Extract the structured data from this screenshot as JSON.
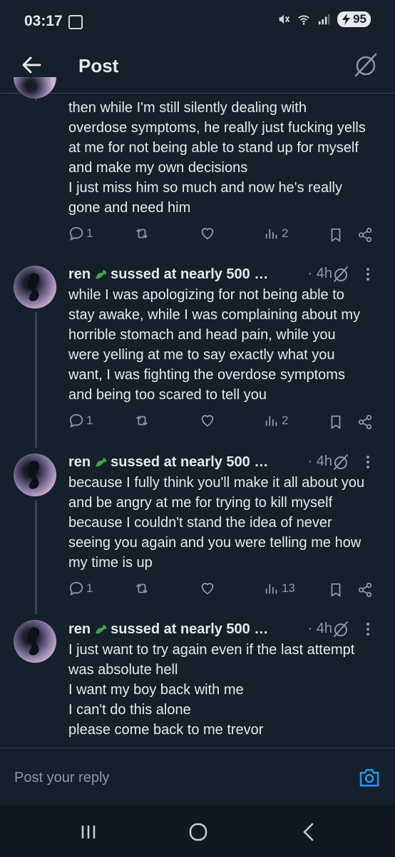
{
  "status_bar": {
    "time": "03:17",
    "battery": "95"
  },
  "header": {
    "title": "Post"
  },
  "posts": [
    {
      "text": "then while I'm still silently dealing with\noverdose symptoms, he really just fucking yells\nat me for not being able to stand up for myself\nand make my own decisions\nI just miss him so much and now he's really\ngone and need him",
      "replies": "1",
      "reposts": "",
      "likes": "",
      "views": "2"
    },
    {
      "author": "ren",
      "handle": "sussed at nearly 500 …",
      "time": "· 4h",
      "text": "while I was apologizing for not being able to\nstay awake, while I was complaining about my\nhorrible stomach and head pain, while you\nwere yelling at me to say exactly what you\nwant, I was fighting the overdose symptoms\nand being too scared to tell you",
      "replies": "1",
      "reposts": "",
      "likes": "",
      "views": "2"
    },
    {
      "author": "ren",
      "handle": "sussed at nearly 500 …",
      "time": "· 4h",
      "text": "because I fully think you'll make it all about you\nand be angry at me for trying to kill myself\nbecause I couldn't stand the idea of never\nseeing you again and you were telling me how\nmy time is up",
      "replies": "1",
      "reposts": "",
      "likes": "",
      "views": "13"
    },
    {
      "author": "ren",
      "handle": "sussed at nearly 500 …",
      "time": "· 4h",
      "text": "I just want to try again even if the last attempt\nwas absolute hell\nI want my boy back with me\nI can't do this alone\nplease come back to me trevor"
    }
  ],
  "composer": {
    "placeholder": "Post your reply"
  },
  "colors": {
    "background": "#15202b",
    "text": "#e7e9ea",
    "muted": "#8b98a5",
    "accent": "#1d9bf0",
    "border": "#38444d"
  }
}
